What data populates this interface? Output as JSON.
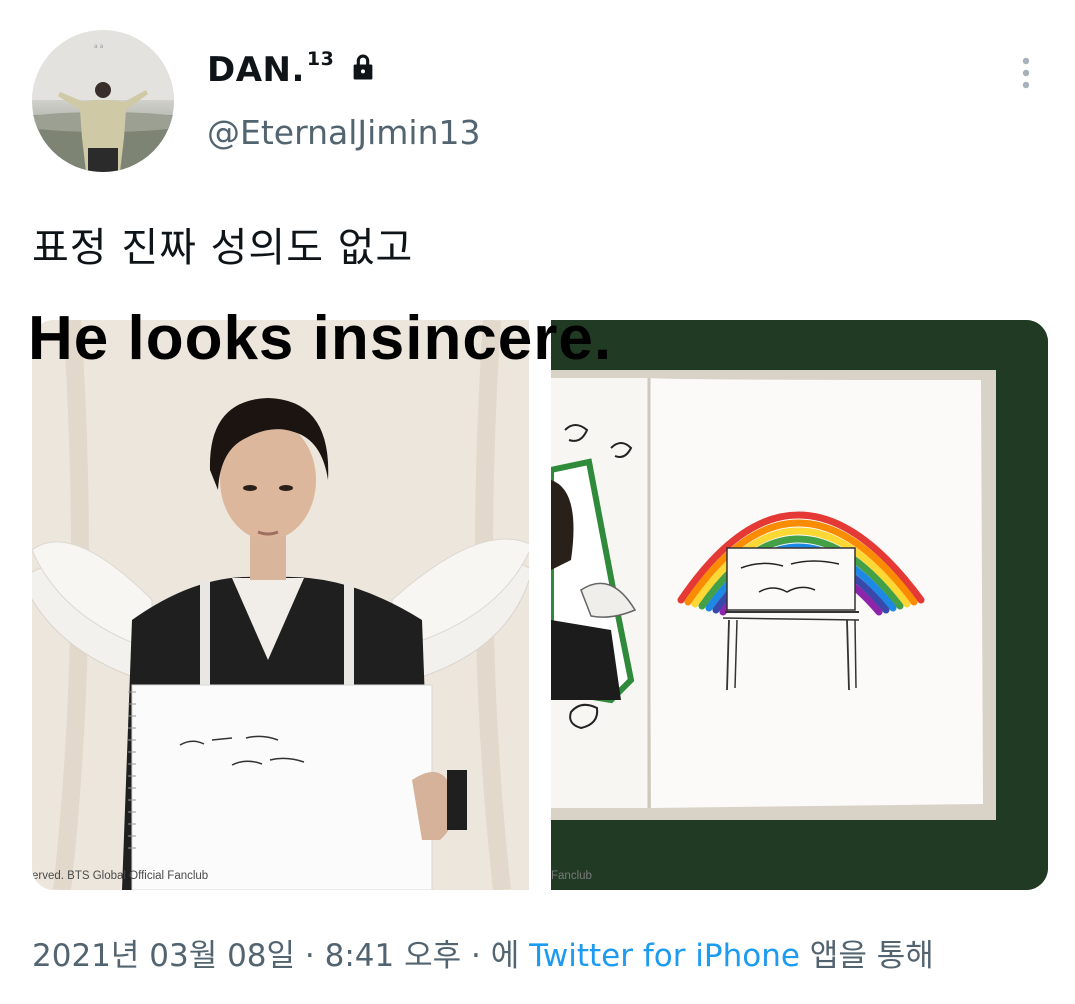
{
  "header": {
    "display_name": "DAN.",
    "name_superscript": "13",
    "handle": "@EternalJimin13",
    "protected_icon": "lock-icon",
    "more_icon": "more-vertical-icon"
  },
  "tweet": {
    "text": "표정 진짜 성의도 없고",
    "overlay_caption": "He looks insincere."
  },
  "media": {
    "left_watermark": "erved. BTS Global Official Fanclub",
    "right_watermark": "Fanclub"
  },
  "meta": {
    "date": "2021년 03월 08일",
    "separator1": " · ",
    "time": "8:41 오후",
    "separator2": " · 에 ",
    "source": "Twitter for iPhone",
    "suffix": " 앱을 통해"
  },
  "colors": {
    "secondary_text": "#536471",
    "link": "#1d9bf0"
  }
}
